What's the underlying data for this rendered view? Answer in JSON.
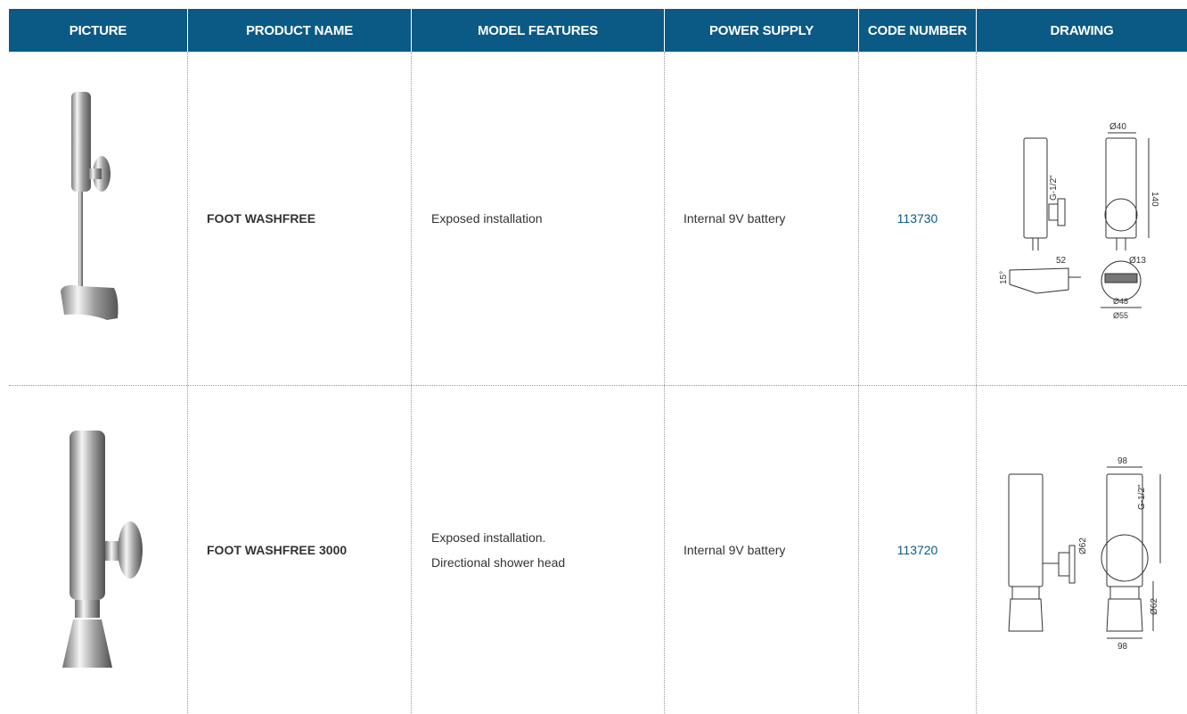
{
  "headers": {
    "picture": "PICTURE",
    "product_name": "PRODUCT NAME",
    "model_features": "MODEL FEATURES",
    "power_supply": "POWER SUPPLY",
    "code_number": "CODE NUMBER",
    "drawing": "DRAWING"
  },
  "rows": [
    {
      "product_name": "FOOT WASHFREE",
      "features_line1": "Exposed installation",
      "features_line2": "",
      "power_supply": "Internal 9V battery",
      "code_number": "113730",
      "drawing_labels": [
        "Ø40",
        "140",
        "G-1/2\"",
        "52",
        "Ø13",
        "15°",
        "Ø48",
        "Ø55"
      ]
    },
    {
      "product_name": "FOOT WASHFREE 3000",
      "features_line1": "Exposed installation.",
      "features_line2": "Directional shower head",
      "power_supply": "Internal 9V battery",
      "code_number": "113720",
      "drawing_labels": [
        "98",
        "G-1/2\"",
        "Ø62",
        "Ø62",
        "98"
      ]
    }
  ]
}
